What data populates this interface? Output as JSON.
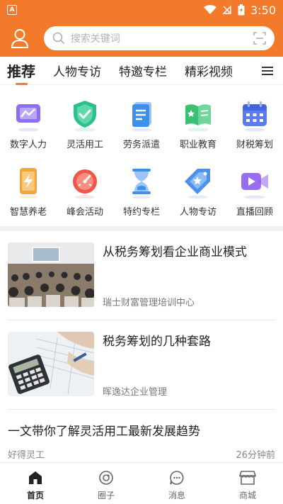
{
  "status_bar": {
    "time": "3:50"
  },
  "search": {
    "placeholder": "搜索关键词"
  },
  "tabs": [
    {
      "label": "推荐",
      "active": true
    },
    {
      "label": "人物专访",
      "active": false
    },
    {
      "label": "特邀专栏",
      "active": false
    },
    {
      "label": "精彩视频",
      "active": false
    }
  ],
  "categories": [
    {
      "label": "数字人力",
      "icon": "chart-screen-icon"
    },
    {
      "label": "灵活用工",
      "icon": "shield-check-icon"
    },
    {
      "label": "劳务派遣",
      "icon": "document-icon"
    },
    {
      "label": "职业教育",
      "icon": "open-book-icon"
    },
    {
      "label": "财税筹划",
      "icon": "calendar-icon"
    },
    {
      "label": "智慧养老",
      "icon": "phone-bolt-icon"
    },
    {
      "label": "峰会活动",
      "icon": "gauge-icon"
    },
    {
      "label": "特约专栏",
      "icon": "hourglass-icon"
    },
    {
      "label": "人物专访",
      "icon": "star-tag-icon"
    },
    {
      "label": "直播回顾",
      "icon": "video-camera-icon"
    }
  ],
  "articles": [
    {
      "title": "从税务筹划看企业商业模式",
      "source": "瑞士财富管理培训中心"
    },
    {
      "title": "税务筹划的几种套路",
      "source": "晖逸达企业管理"
    }
  ],
  "text_article": {
    "title": "一文带你了解灵活用工最新发展趋势",
    "source": "好得灵工",
    "time": "26分钟前"
  },
  "bottom_nav": [
    {
      "label": "首页",
      "active": true
    },
    {
      "label": "圈子",
      "active": false
    },
    {
      "label": "消息",
      "active": false
    },
    {
      "label": "商城",
      "active": false
    }
  ],
  "colors": {
    "brand": "#f47a2b"
  }
}
